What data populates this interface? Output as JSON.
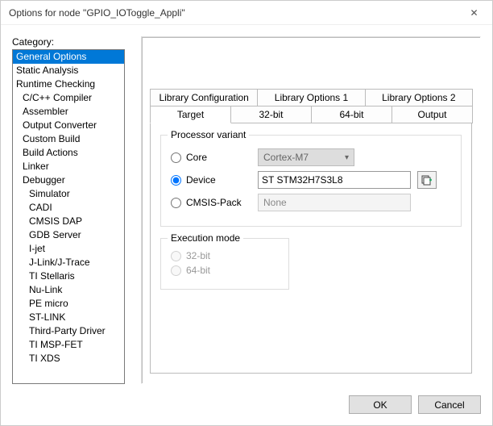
{
  "window": {
    "title": "Options for node \"GPIO_IOToggle_Appli\""
  },
  "category": {
    "label": "Category:",
    "items": [
      "General Options",
      "Static Analysis",
      "Runtime Checking",
      "C/C++ Compiler",
      "Assembler",
      "Output Converter",
      "Custom Build",
      "Build Actions",
      "Linker",
      "Debugger",
      "Simulator",
      "CADI",
      "CMSIS DAP",
      "GDB Server",
      "I-jet",
      "J-Link/J-Trace",
      "TI Stellaris",
      "Nu-Link",
      "PE micro",
      "ST-LINK",
      "Third-Party Driver",
      "TI MSP-FET",
      "TI XDS"
    ]
  },
  "tabs": {
    "row1": [
      "Library Configuration",
      "Library Options 1",
      "Library Options 2"
    ],
    "row2": [
      "Target",
      "32-bit",
      "64-bit",
      "Output"
    ],
    "active": "Target"
  },
  "processor": {
    "legend": "Processor variant",
    "core_label": "Core",
    "core_value": "Cortex-M7",
    "device_label": "Device",
    "device_value": "ST STM32H7S3L8",
    "cmsis_label": "CMSIS-Pack",
    "cmsis_value": "None"
  },
  "exec": {
    "legend": "Execution mode",
    "opt32": "32-bit",
    "opt64": "64-bit"
  },
  "footer": {
    "ok": "OK",
    "cancel": "Cancel"
  }
}
